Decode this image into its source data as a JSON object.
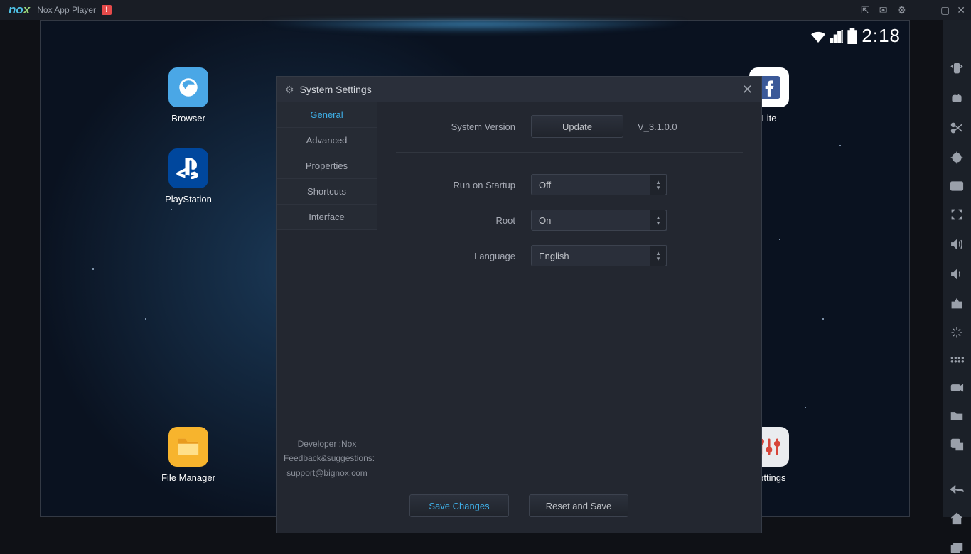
{
  "titlebar": {
    "appname": "Nox App Player",
    "alert": "!"
  },
  "statusbar": {
    "clock": "2:18"
  },
  "desktop_icons": {
    "browser": "Browser",
    "playstation": "PlayStation",
    "file_manager": "File Manager",
    "lite": "Lite",
    "settings": "Settings"
  },
  "dialog": {
    "title": "System Settings",
    "tabs": [
      "General",
      "Advanced",
      "Properties",
      "Shortcuts",
      "Interface"
    ],
    "info": {
      "developer": "Developer :Nox",
      "feedback": "Feedback&suggestions:",
      "email": "support@bignox.com"
    },
    "rows": {
      "system_version": {
        "label": "System Version",
        "button": "Update",
        "value": "V_3.1.0.0"
      },
      "run_on_startup": {
        "label": "Run on Startup",
        "value": "Off"
      },
      "root": {
        "label": "Root",
        "value": "On"
      },
      "language": {
        "label": "Language",
        "value": "English"
      }
    },
    "footer": {
      "save": "Save Changes",
      "reset": "Reset and Save"
    }
  }
}
